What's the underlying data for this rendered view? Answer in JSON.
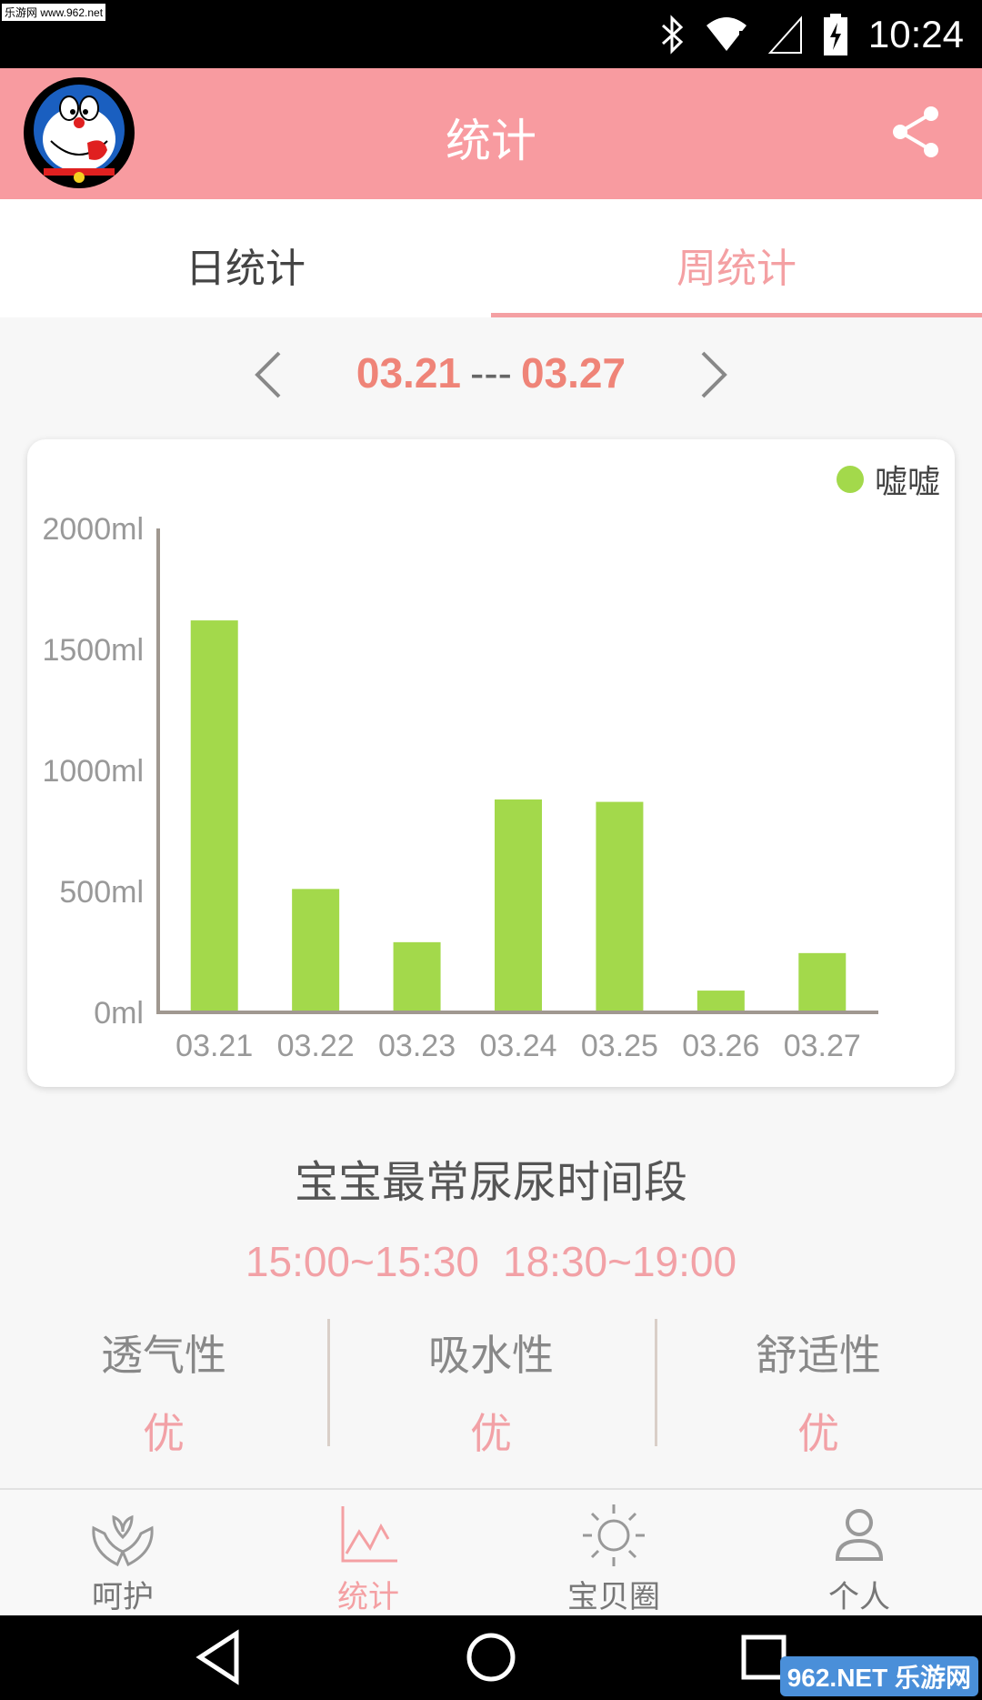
{
  "status_bar": {
    "watermark": "乐游网 www.962.net",
    "time": "10:24"
  },
  "app_bar": {
    "title": "统计"
  },
  "tabs": [
    {
      "label": "日统计",
      "active": false
    },
    {
      "label": "周统计",
      "active": true
    }
  ],
  "week_nav": {
    "start": "03.21",
    "separator": "---",
    "end": "03.27"
  },
  "chart_data": {
    "type": "bar",
    "categories": [
      "03.21",
      "03.22",
      "03.23",
      "03.24",
      "03.25",
      "03.26",
      "03.27"
    ],
    "series": [
      {
        "name": "嘘嘘",
        "color": "#a3d94b",
        "values": [
          1620,
          510,
          290,
          880,
          870,
          90,
          245
        ]
      }
    ],
    "y_ticks": [
      "0ml",
      "500ml",
      "1000ml",
      "1500ml",
      "2000ml"
    ],
    "ylim": [
      0,
      2000
    ],
    "legend_position": "top-right",
    "grid": false
  },
  "summary": {
    "title": "宝宝最常尿尿时间段",
    "time_ranges": [
      "15:00~15:30",
      "18:30~19:00"
    ],
    "metrics": [
      {
        "label": "透气性",
        "value": "优"
      },
      {
        "label": "吸水性",
        "value": "优"
      },
      {
        "label": "舒适性",
        "value": "优"
      }
    ]
  },
  "bottom_nav": [
    {
      "label": "呵护",
      "icon": "care-hands-icon",
      "active": false
    },
    {
      "label": "统计",
      "icon": "chart-icon",
      "active": true
    },
    {
      "label": "宝贝圈",
      "icon": "sun-icon",
      "active": false
    },
    {
      "label": "个人",
      "icon": "person-icon",
      "active": false
    }
  ],
  "system_nav": {
    "watermark": "962.NET 乐游网"
  },
  "colors": {
    "primary": "#f89ba0",
    "accent_text": "#ef8478",
    "bar": "#a3d94b"
  }
}
